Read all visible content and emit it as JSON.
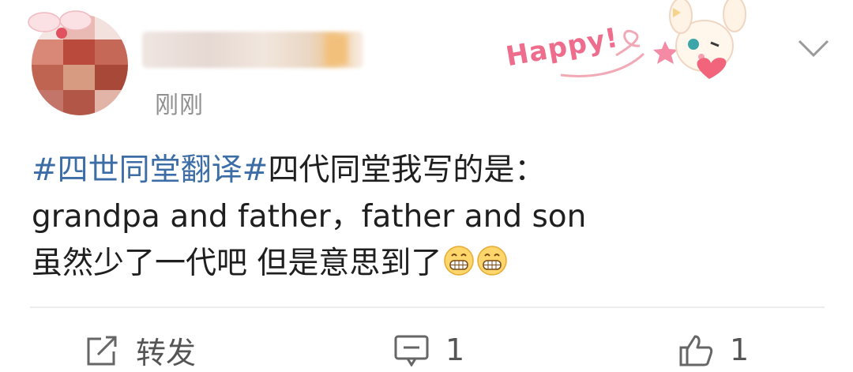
{
  "post": {
    "author": {
      "timestamp": "刚刚"
    },
    "sticker_text": "Happy!",
    "body": {
      "line1_hashtag": "#四世同堂翻译#",
      "line1_text": "四代同堂我写的是：",
      "line2_text": "grandpa and father，father and son",
      "line3_text": "虽然少了一代吧 但是意思到了",
      "emojis": [
        "grinning-face-icon",
        "grinning-face-icon"
      ]
    },
    "actions": {
      "repost_label": "转发",
      "comment_count": "1",
      "like_count": "1"
    }
  },
  "colors": {
    "hashtag": "#3c6da6",
    "timestamp": "#8f8f8f",
    "sticker": "#ef6d8c"
  }
}
